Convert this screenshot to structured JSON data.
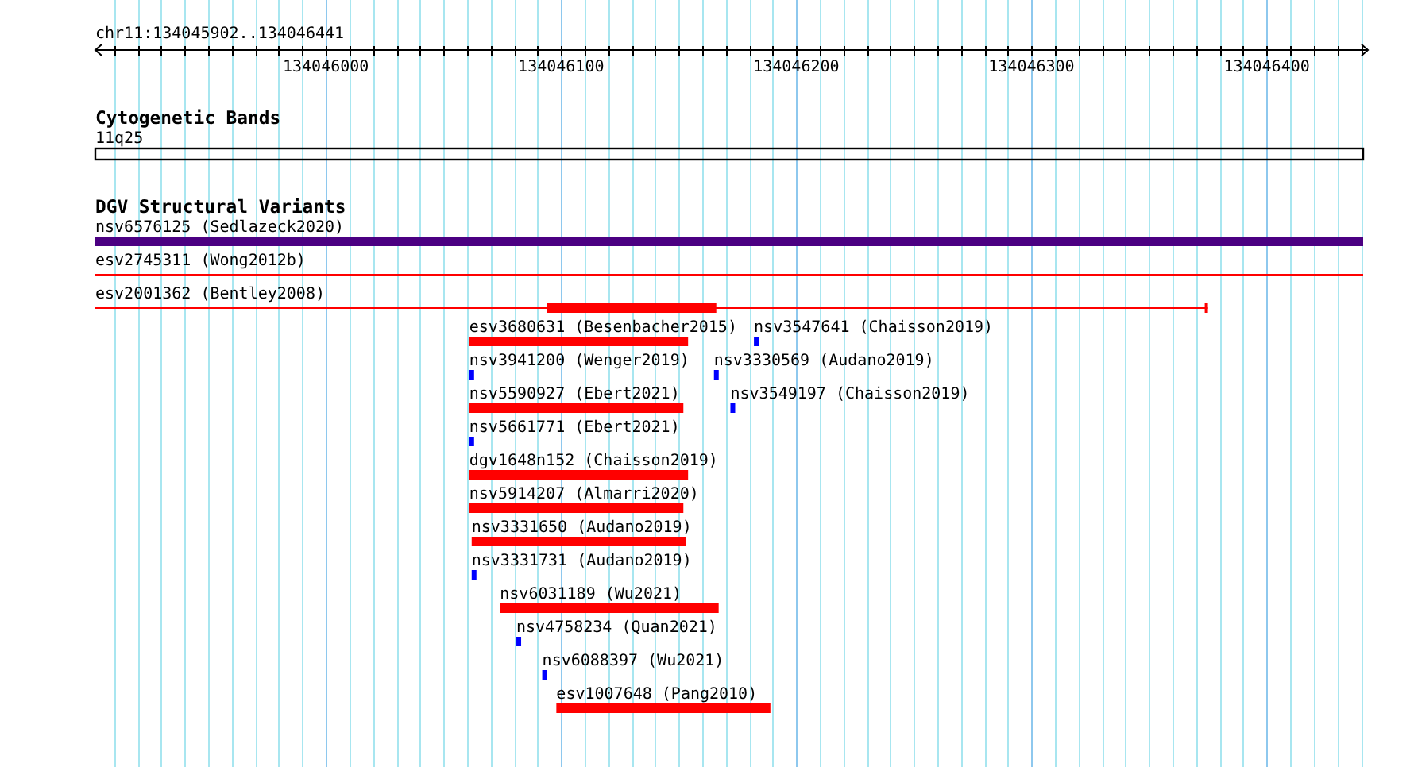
{
  "ruler": {
    "title": "chr11:134045902..134046441",
    "tick_labels": [
      "134046000",
      "134046100",
      "134046200",
      "134046300",
      "134046400"
    ]
  },
  "tracks": [
    {
      "title": "Cytogenetic Bands",
      "rows": [
        {
          "features": [
            {
              "label": "11q25",
              "kind": "band",
              "color": "#000000"
            }
          ]
        }
      ]
    },
    {
      "title": "DGV Structural Variants",
      "rows": [
        {
          "features": [
            {
              "label": "nsv6576125 (Sedlazeck2020)",
              "kind": "bar",
              "color": "#4b0082"
            }
          ]
        },
        {
          "features": [
            {
              "label": "esv2745311 (Wong2012b)",
              "kind": "line",
              "color": "#ff0000"
            }
          ]
        },
        {
          "features": [
            {
              "label": "esv2001362 (Bentley2008)",
              "kind": "gapped",
              "color": "#ff0000"
            }
          ]
        },
        {
          "features": [
            {
              "label": "esv3680631 (Besenbacher2015)",
              "kind": "bar",
              "color": "#ff0000"
            },
            {
              "label": "nsv3547641 (Chaisson2019)",
              "kind": "tick",
              "color": "#0000ff"
            }
          ]
        },
        {
          "features": [
            {
              "label": "nsv3941200 (Wenger2019)",
              "kind": "tick",
              "color": "#0000ff"
            },
            {
              "label": "nsv3330569 (Audano2019)",
              "kind": "tick",
              "color": "#0000ff"
            }
          ]
        },
        {
          "features": [
            {
              "label": "nsv5590927 (Ebert2021)",
              "kind": "bar",
              "color": "#ff0000"
            },
            {
              "label": "nsv3549197 (Chaisson2019)",
              "kind": "tick",
              "color": "#0000ff"
            }
          ]
        },
        {
          "features": [
            {
              "label": "nsv5661771 (Ebert2021)",
              "kind": "tick",
              "color": "#0000ff"
            }
          ]
        },
        {
          "features": [
            {
              "label": "dgv1648n152 (Chaisson2019)",
              "kind": "bar",
              "color": "#ff0000"
            }
          ]
        },
        {
          "features": [
            {
              "label": "nsv5914207 (Almarri2020)",
              "kind": "bar",
              "color": "#ff0000"
            }
          ]
        },
        {
          "features": [
            {
              "label": "nsv3331650 (Audano2019)",
              "kind": "bar",
              "color": "#ff0000"
            }
          ]
        },
        {
          "features": [
            {
              "label": "nsv3331731 (Audano2019)",
              "kind": "tick",
              "color": "#0000ff"
            }
          ]
        },
        {
          "features": [
            {
              "label": "nsv6031189 (Wu2021)",
              "kind": "bar",
              "color": "#ff0000"
            }
          ]
        },
        {
          "features": [
            {
              "label": "nsv4758234 (Quan2021)",
              "kind": "tick",
              "color": "#0000ff"
            }
          ]
        },
        {
          "features": [
            {
              "label": "nsv6088397 (Wu2021)",
              "kind": "tick",
              "color": "#0000ff"
            }
          ]
        },
        {
          "features": [
            {
              "label": "esv1007648 (Pang2010)",
              "kind": "bar",
              "color": "#ff0000"
            }
          ]
        }
      ]
    }
  ]
}
